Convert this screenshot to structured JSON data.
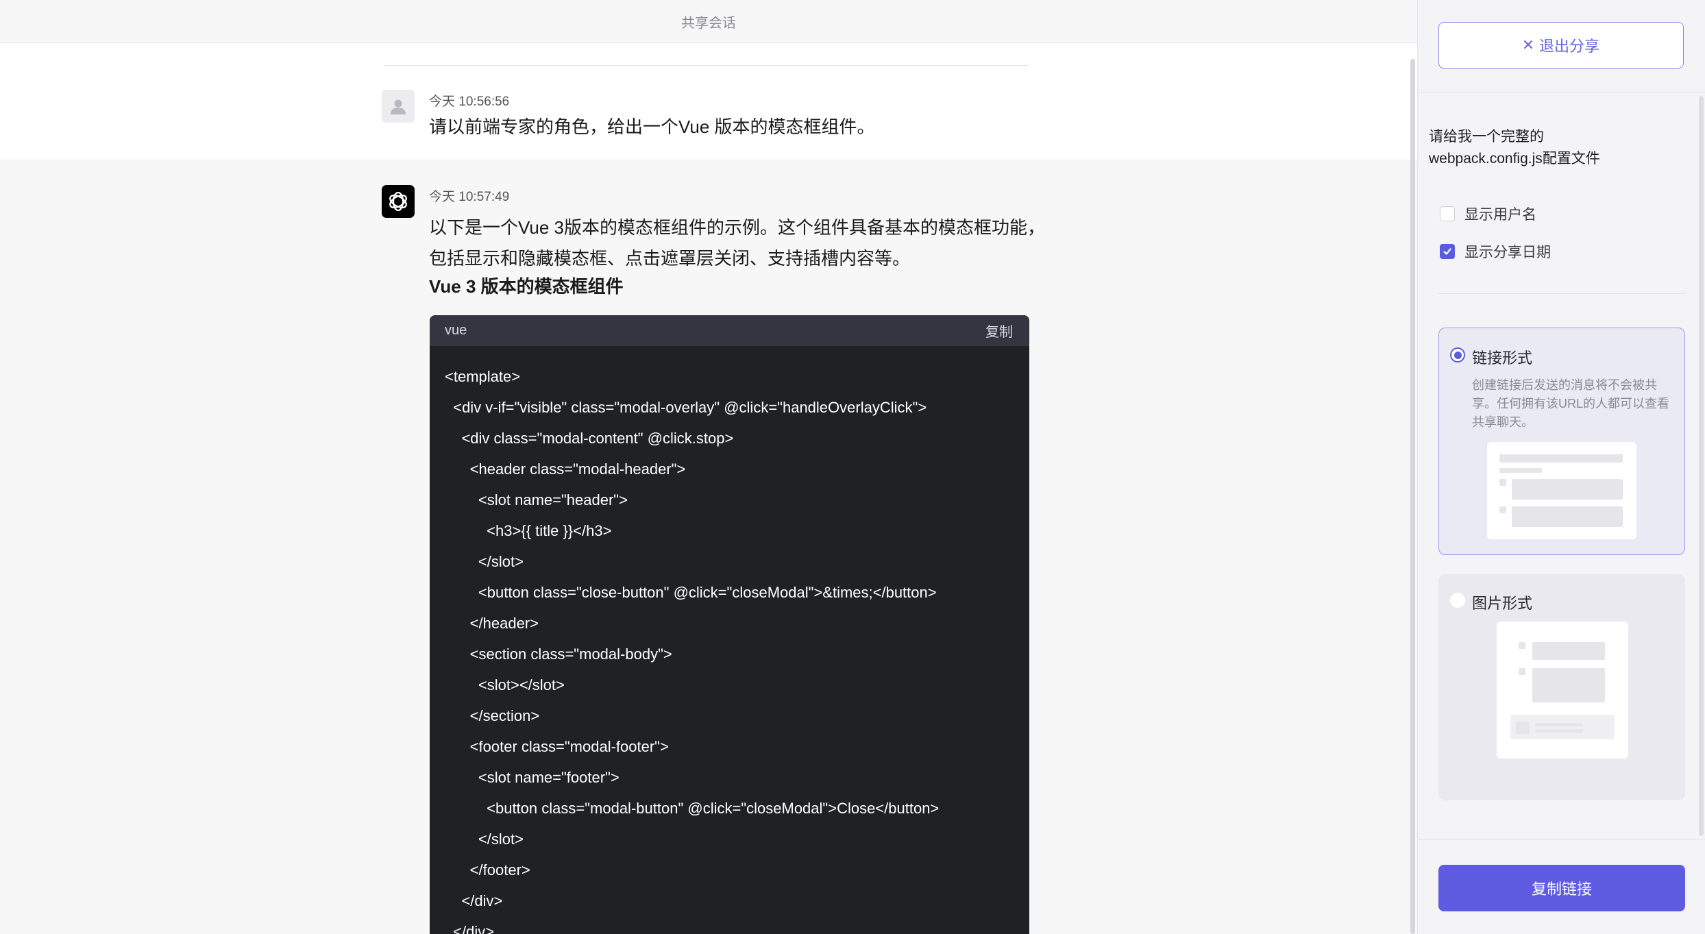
{
  "header": {
    "title": "共享会话"
  },
  "user_message": {
    "timestamp": "今天 10:56:56",
    "text": "请以前端专家的角色，给出一个Vue 版本的模态框组件。"
  },
  "assistant_message": {
    "timestamp": "今天 10:57:49",
    "lines": [
      "以下是一个Vue 3版本的模态框组件的示例。这个组件具备基本的模态框功能，",
      "包括显示和隐藏模态框、点击遮罩层关闭、支持插槽内容等。"
    ],
    "heading": "Vue 3 版本的模态框组件",
    "code": {
      "language": "vue",
      "copy_label": "复制",
      "lines": [
        "<template>",
        "  <div v-if=\"visible\" class=\"modal-overlay\" @click=\"handleOverlayClick\">",
        "    <div class=\"modal-content\" @click.stop>",
        "      <header class=\"modal-header\">",
        "        <slot name=\"header\">",
        "          <h3>{{ title }}</h3>",
        "        </slot>",
        "        <button class=\"close-button\" @click=\"closeModal\">&times;</button>",
        "      </header>",
        "      <section class=\"modal-body\">",
        "        <slot></slot>",
        "      </section>",
        "      <footer class=\"modal-footer\">",
        "        <slot name=\"footer\">",
        "          <button class=\"modal-button\" @click=\"closeModal\">Close</button>",
        "        </slot>",
        "      </footer>",
        "    </div>",
        "  </div>"
      ]
    }
  },
  "share_panel": {
    "exit_label": "退出分享",
    "title": "请给我一个完整的webpack.config.js配置文件",
    "options": [
      {
        "label": "显示用户名",
        "checked": false
      },
      {
        "label": "显示分享日期",
        "checked": true
      }
    ],
    "link_mode": {
      "label": "链接形式",
      "selected": true,
      "description": "创建链接后发送的消息将不会被共享。任何拥有该URL的人都可以查看共享聊天。"
    },
    "image_mode": {
      "label": "图片形式",
      "selected": false
    },
    "copy_link_label": "复制链接"
  },
  "colors": {
    "accent": "#5f5ce2",
    "code_bg": "#202123",
    "code_header": "#343541"
  },
  "icons": [
    "user-avatar-icon",
    "openai-logo-icon",
    "close-icon",
    "check-icon"
  ]
}
